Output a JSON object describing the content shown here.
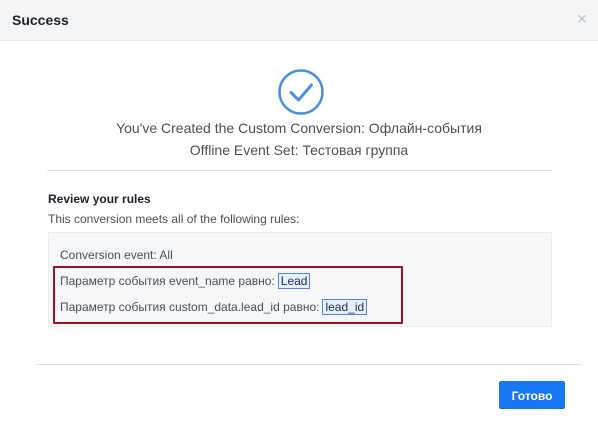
{
  "dialog": {
    "title": "Success",
    "close_glyph": "×"
  },
  "summary": {
    "line1": "You've Created the Custom Conversion: Офлайн-события",
    "line2": "Offline Event Set: Тестовая группа",
    "icon": "checkmark-circle-icon"
  },
  "review": {
    "title": "Review your rules",
    "subtitle": "This conversion meets all of the following rules:",
    "rules": [
      {
        "label": "Conversion event:  All",
        "value": ""
      },
      {
        "label": "Параметр события event_name равно:",
        "value": "Lead"
      },
      {
        "label": "Параметр события custom_data.lead_id равно:",
        "value": "lead_id"
      }
    ]
  },
  "footer": {
    "done_label": "Готово"
  },
  "colors": {
    "accent": "#1877f2",
    "check": "#4a90e2",
    "highlight_border": "#9b1222",
    "token_border": "#4d87d6"
  }
}
